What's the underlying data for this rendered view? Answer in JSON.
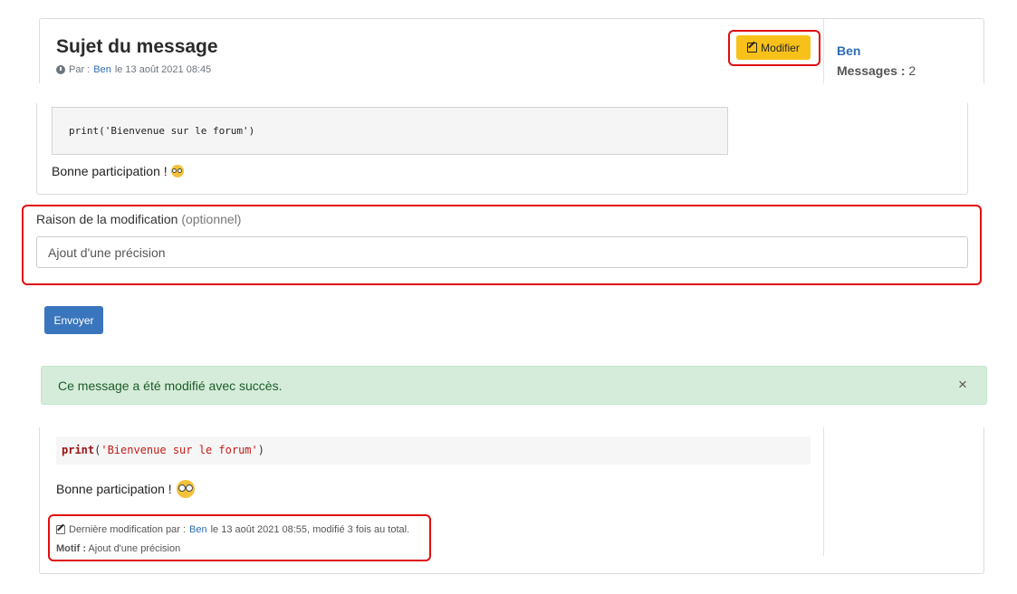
{
  "post": {
    "subject": "Sujet du message",
    "meta_prefix": "Par :",
    "author": "Ben",
    "meta_date": "le 13 août 2021 08:45",
    "modify_label": "Modifier",
    "sidebar_author": "Ben",
    "messages_label": "Messages :",
    "messages_count": "2"
  },
  "editor": {
    "code": "print('Bienvenue sur le forum')",
    "text": "Bonne participation !",
    "emoji_icon": "nerd-face-emoji",
    "reason_label": "Raison de la modification",
    "reason_optional": "(optionnel)",
    "reason_value": "Ajout d'une précision",
    "send_label": "Envoyer"
  },
  "alert": {
    "message": "Ce message a été modifié avec succès.",
    "close_icon": "close-icon"
  },
  "result": {
    "code_keyword": "print",
    "code_open": "(",
    "code_string": "'Bienvenue sur le forum'",
    "code_close": ")",
    "text": "Bonne participation !",
    "lastmod_prefix": "Dernière modification par :",
    "lastmod_author": "Ben",
    "lastmod_suffix": "le 13 août 2021 08:55, modifié 3 fois au total.",
    "motif_label": "Motif :",
    "motif_value": "Ajout d'une précision"
  },
  "colors": {
    "accent_red": "#e00d0d",
    "button_yellow": "#f8c119",
    "button_blue": "#3a76bd",
    "alert_green": "#d4ecd9",
    "link_blue": "#2f6db3"
  }
}
